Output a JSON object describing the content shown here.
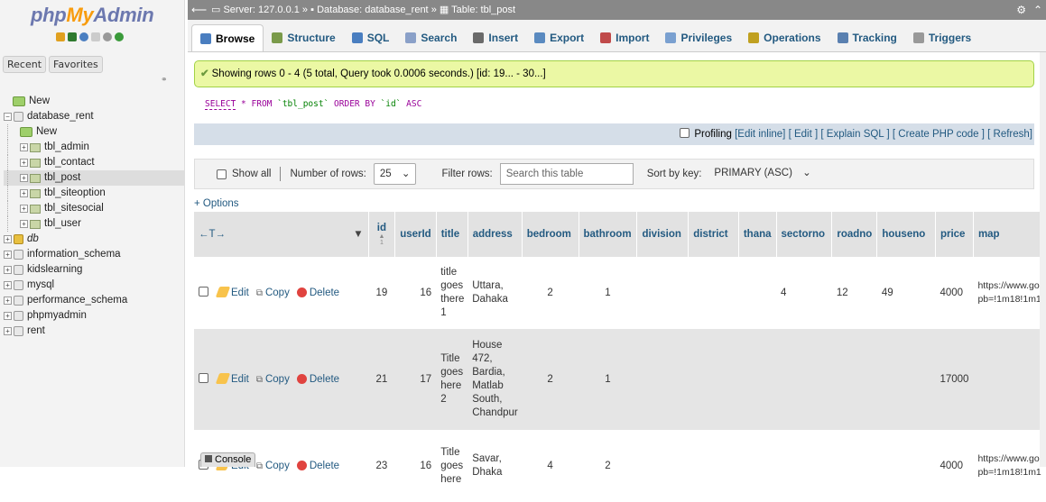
{
  "logo": {
    "php": "php",
    "my": "My",
    "admin": "Admin"
  },
  "sidebar": {
    "recent_tab": "Recent",
    "favorites_tab": "Favorites",
    "tree": [
      {
        "label": "New",
        "kind": "new",
        "level": 0
      },
      {
        "label": "database_rent",
        "kind": "db",
        "level": 0,
        "expanded": true
      },
      {
        "label": "New",
        "kind": "new",
        "level": 1
      },
      {
        "label": "tbl_admin",
        "kind": "table",
        "level": 1
      },
      {
        "label": "tbl_contact",
        "kind": "table",
        "level": 1
      },
      {
        "label": "tbl_post",
        "kind": "table",
        "level": 1,
        "selected": true
      },
      {
        "label": "tbl_siteoption",
        "kind": "table",
        "level": 1
      },
      {
        "label": "tbl_sitesocial",
        "kind": "table",
        "level": 1
      },
      {
        "label": "tbl_user",
        "kind": "table",
        "level": 1
      },
      {
        "label": "db",
        "kind": "db-italic",
        "level": 0
      },
      {
        "label": "information_schema",
        "kind": "db",
        "level": 0
      },
      {
        "label": "kidslearning",
        "kind": "db",
        "level": 0
      },
      {
        "label": "mysql",
        "kind": "db",
        "level": 0
      },
      {
        "label": "performance_schema",
        "kind": "db",
        "level": 0
      },
      {
        "label": "phpmyadmin",
        "kind": "db",
        "level": 0
      },
      {
        "label": "rent",
        "kind": "db",
        "level": 0
      }
    ]
  },
  "breadcrumb": {
    "server": "Server: 127.0.0.1",
    "database": "Database: database_rent",
    "table": "Table: tbl_post",
    "sep": "»"
  },
  "tabs": [
    {
      "label": "Browse",
      "icon": "browse-icon",
      "active": true
    },
    {
      "label": "Structure",
      "icon": "structure-icon"
    },
    {
      "label": "SQL",
      "icon": "sql-icon"
    },
    {
      "label": "Search",
      "icon": "search-icon"
    },
    {
      "label": "Insert",
      "icon": "insert-icon"
    },
    {
      "label": "Export",
      "icon": "export-icon"
    },
    {
      "label": "Import",
      "icon": "import-icon"
    },
    {
      "label": "Privileges",
      "icon": "privileges-icon"
    },
    {
      "label": "Operations",
      "icon": "operations-icon"
    },
    {
      "label": "Tracking",
      "icon": "tracking-icon"
    },
    {
      "label": "Triggers",
      "icon": "triggers-icon"
    }
  ],
  "message": {
    "text": "Showing rows 0 - 4 (5 total, Query took 0.0006 seconds.) [id: 19... - 30...]"
  },
  "sql": {
    "select": "SELECT",
    "star": " * ",
    "from": "FROM",
    "table": " `tbl_post` ",
    "order": "ORDER BY",
    "col": " `id` ",
    "asc": "ASC"
  },
  "sql_options": {
    "profiling": "Profiling",
    "edit_inline": "[Edit inline]",
    "edit": "[ Edit ]",
    "explain": "[ Explain SQL ]",
    "create_php": "[ Create PHP code ]",
    "refresh": "[ Refresh]"
  },
  "navigation": {
    "show_all": "Show all",
    "number_of_rows_label": "Number of rows:",
    "number_of_rows_value": "25",
    "filter_rows_label": "Filter rows:",
    "filter_placeholder": "Search this table",
    "sort_by_key_label": "Sort by key:",
    "sort_by_key_value": "PRIMARY (ASC)"
  },
  "options_link": "+ Options",
  "table": {
    "arrows": "←T→",
    "columns": [
      "id",
      "userId",
      "title",
      "address",
      "bedroom",
      "bathroom",
      "division",
      "district",
      "thana",
      "sectorno",
      "roadno",
      "houseno",
      "price",
      "map"
    ],
    "sort_indicator": "▲",
    "sort_order": "1",
    "edit_label": "Edit",
    "copy_label": "Copy",
    "delete_label": "Delete",
    "rows": [
      {
        "id": "19",
        "userId": "16",
        "title": "title goes there 1",
        "address": "Uttara, Dahaka",
        "bedroom": "2",
        "bathroom": "1",
        "division": "",
        "district": "",
        "thana": "",
        "sectorno": "4",
        "roadno": "12",
        "houseno": "49",
        "price": "4000",
        "map": "https://www.go pb=!1m18!1m1"
      },
      {
        "id": "21",
        "userId": "17",
        "title": "Title goes here 2",
        "address": "House 472, Bardia, Matlab South, Chandpur",
        "bedroom": "2",
        "bathroom": "1",
        "division": "",
        "district": "",
        "thana": "",
        "sectorno": "",
        "roadno": "",
        "houseno": "",
        "price": "17000",
        "map": ""
      },
      {
        "id": "23",
        "userId": "16",
        "title": "Title goes here",
        "address": "Savar, Dhaka",
        "bedroom": "4",
        "bathroom": "2",
        "division": "",
        "district": "",
        "thana": "",
        "sectorno": "",
        "roadno": "",
        "houseno": "",
        "price": "4000",
        "map": "https://www.go pb=!1m18!1m1"
      }
    ]
  },
  "console": {
    "label": "Console"
  }
}
